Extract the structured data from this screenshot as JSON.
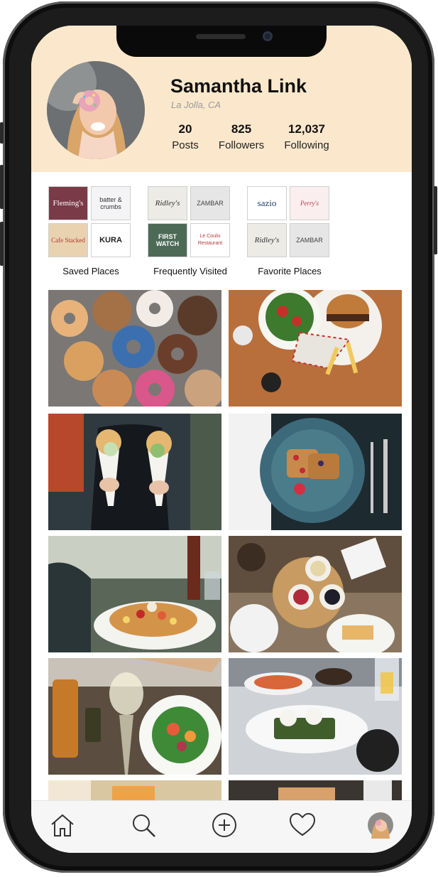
{
  "profile": {
    "name": "Samantha Link",
    "location": "La Jolla, CA",
    "stats": [
      {
        "value": "20",
        "label": "Posts"
      },
      {
        "value": "825",
        "label": "Followers"
      },
      {
        "value": "12,037",
        "label": "Following"
      }
    ]
  },
  "collections": [
    {
      "label": "Saved Places",
      "logos": [
        "Fleming's",
        "batter & crumbs",
        "Cafe Stacked",
        "KURA"
      ]
    },
    {
      "label": "Frequently Visited",
      "logos": [
        "Ridley's",
        "ZAMBAR",
        "FIRST WATCH",
        "Le Coulis Restaurant"
      ]
    },
    {
      "label": "Favorite Places",
      "logos": [
        "sazio",
        "Perry's",
        "Ridley's",
        "ZAMBAR"
      ]
    }
  ],
  "feed": {
    "photos": [
      "donuts",
      "salad-burger-fries",
      "bubble-waffle-ice-cream",
      "berry-toast-plate",
      "pancakes-table",
      "waffles-fruit-board",
      "salad-wine",
      "avocado-egg-toast",
      "partial-photo-left",
      "partial-photo-right"
    ]
  },
  "tabbar": {
    "items": [
      "home-icon",
      "search-icon",
      "add-icon",
      "heart-icon",
      "profile-avatar"
    ]
  },
  "colors": {
    "header_bg": "#fbe8cc",
    "phone_frame": "#1c1c1c",
    "tabbar_bg": "#f6f6f6"
  }
}
